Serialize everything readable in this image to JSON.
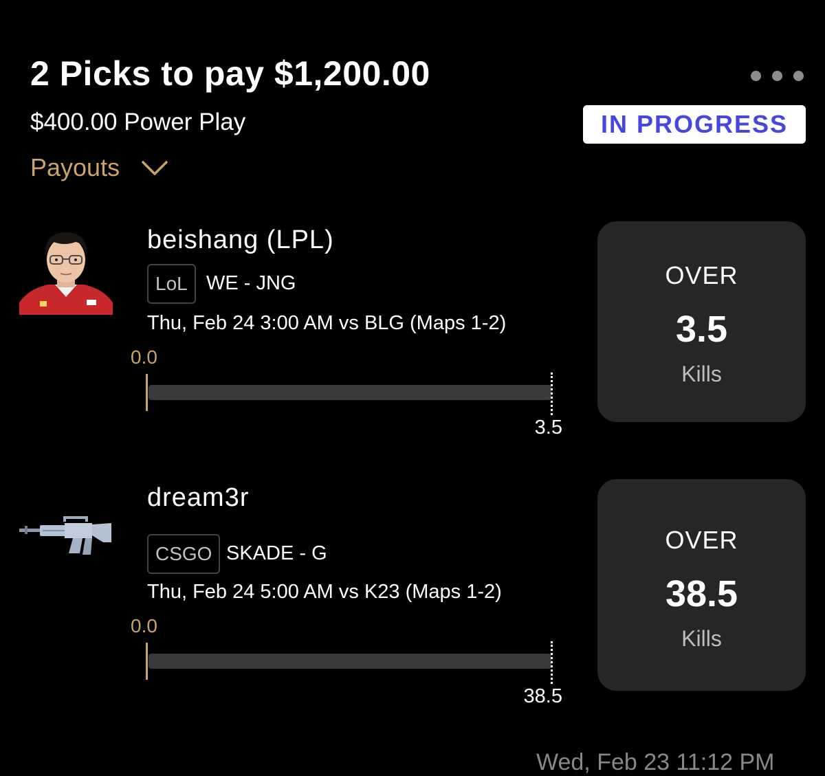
{
  "header": {
    "title": "2 Picks to pay $1,200.00",
    "subtitle": "$400.00 Power Play",
    "status": "IN PROGRESS",
    "payouts_label": "Payouts"
  },
  "colors": {
    "accent": "#caa36b",
    "status_text": "#4747e0",
    "card_bg": "#262626",
    "track": "#3a3a3a"
  },
  "picks": [
    {
      "player_name": "beishang (LPL)",
      "game": "LoL",
      "team_position": "WE - JNG",
      "match_info": "Thu, Feb 24 3:00 AM vs BLG (Maps 1-2)",
      "current": "0.0",
      "target": "3.5",
      "progress_fraction": 0,
      "direction": "OVER",
      "line": "3.5",
      "stat": "Kills",
      "avatar_icon": "player-photo"
    },
    {
      "player_name": "dream3r",
      "game": "CSGO",
      "team_position": "SKADE - G",
      "match_info": "Thu, Feb 24 5:00 AM vs K23 (Maps 1-2)",
      "current": "0.0",
      "target": "38.5",
      "progress_fraction": 0,
      "direction": "OVER",
      "line": "38.5",
      "stat": "Kills",
      "avatar_icon": "rifle-icon"
    }
  ],
  "footer": {
    "timestamp": "Wed, Feb 23 11:12 PM"
  }
}
